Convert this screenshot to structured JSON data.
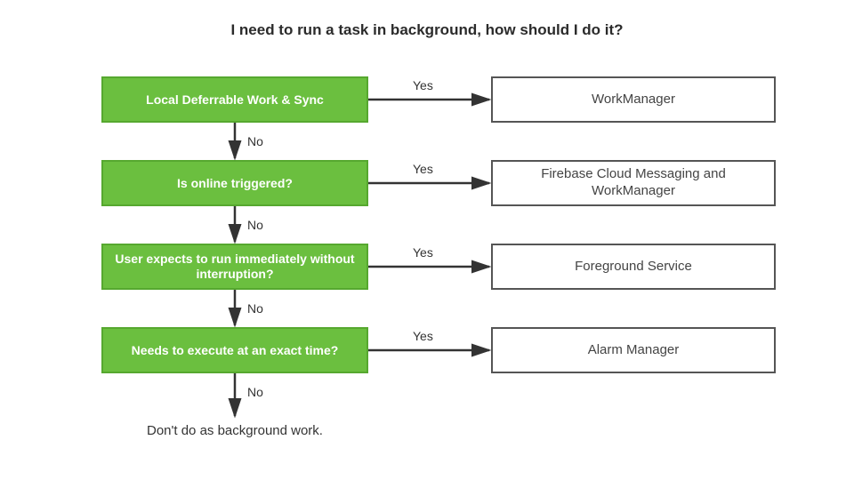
{
  "title": "I need to run a task in background, how should I do it?",
  "labels": {
    "yes": "Yes",
    "no": "No"
  },
  "q1": "Local Deferrable Work & Sync",
  "a1": "WorkManager",
  "q2": "Is online triggered?",
  "a2": "Firebase Cloud Messaging and WorkManager",
  "q3": "User expects to run immediately without interruption?",
  "a3": "Foreground Service",
  "q4": "Needs to execute at an exact time?",
  "a4": "Alarm Manager",
  "final": "Don't do as background work."
}
